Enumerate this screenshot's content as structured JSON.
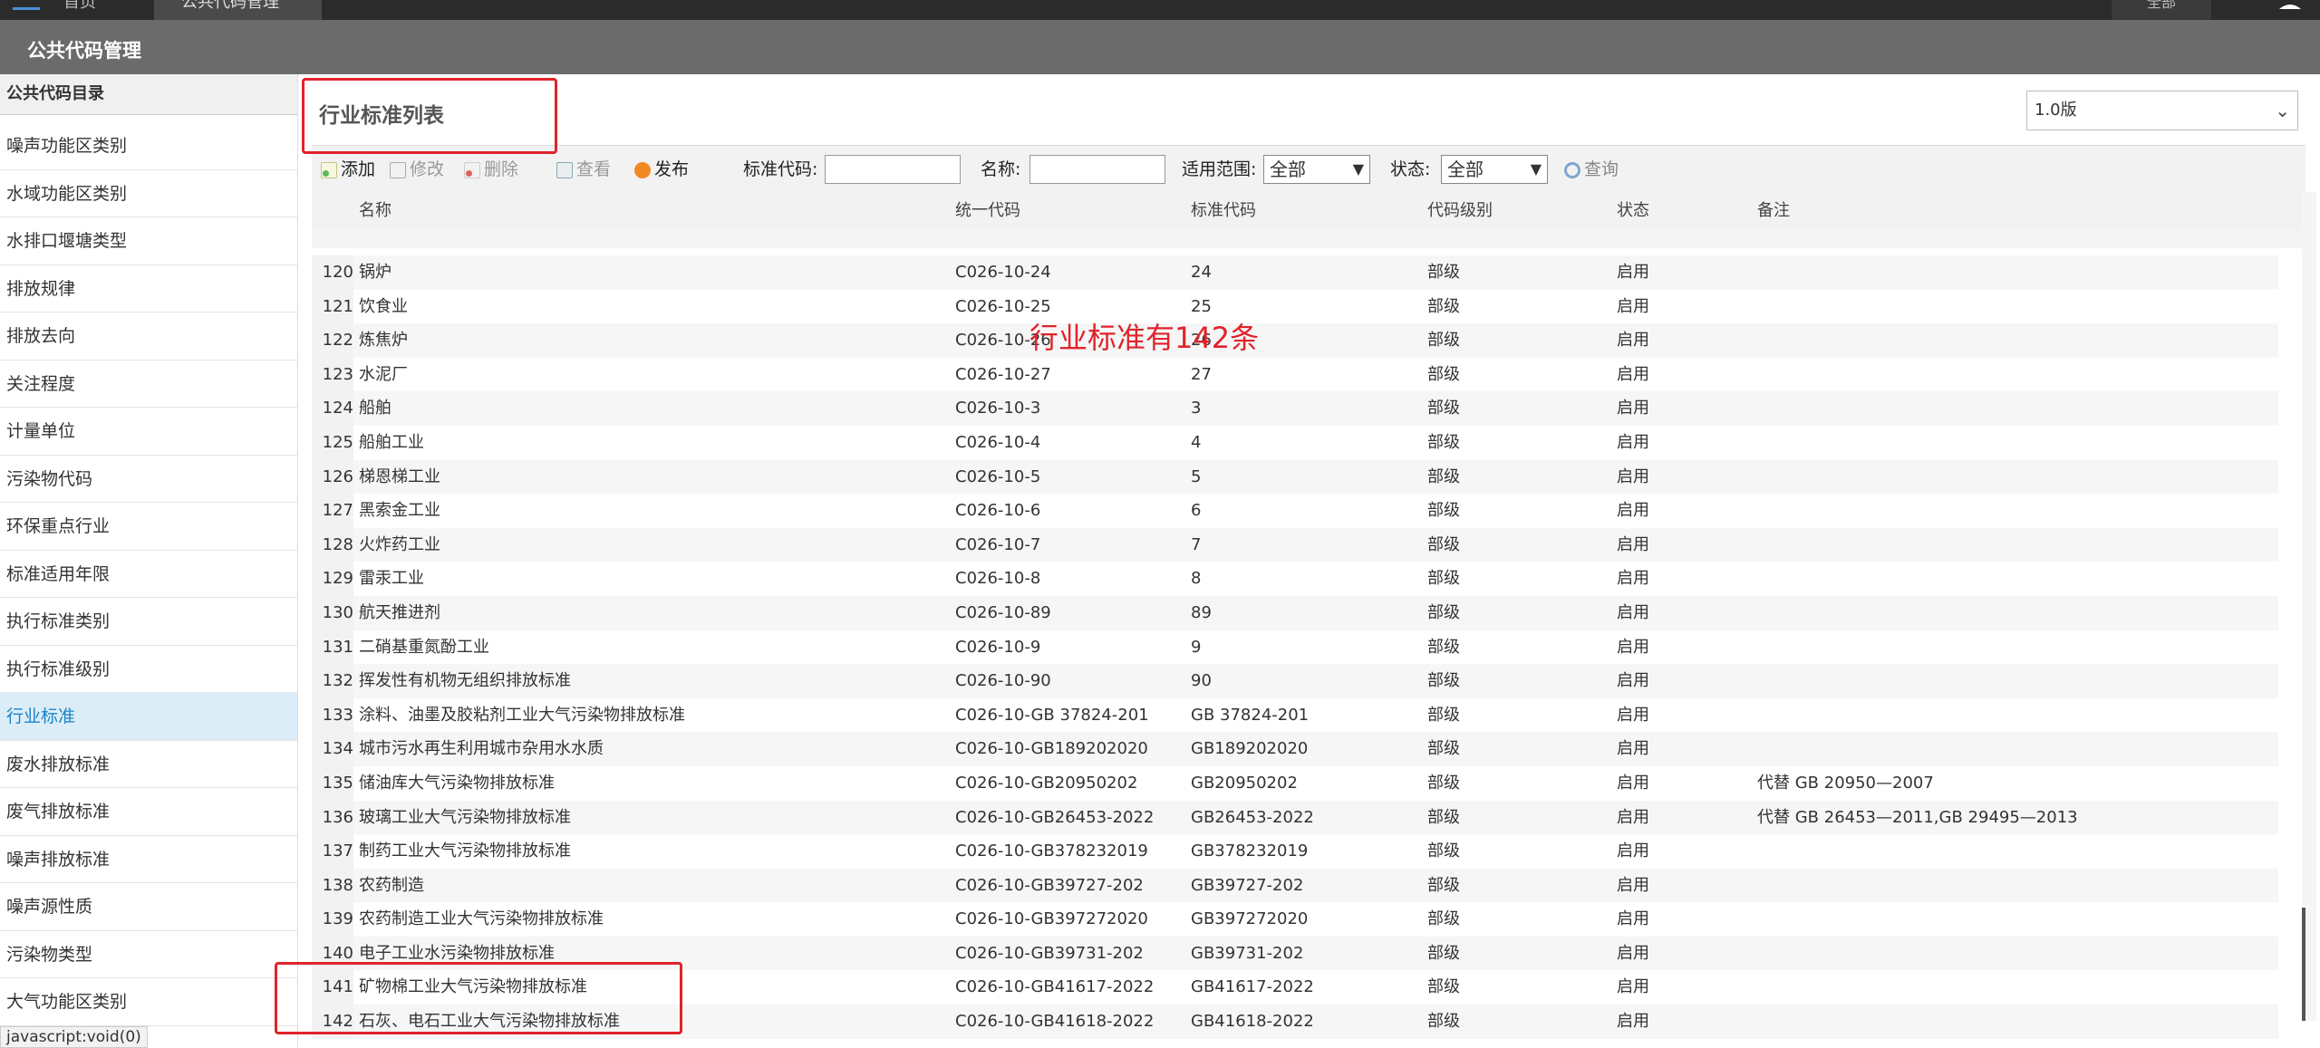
{
  "topbar": {
    "tab1": "首页",
    "tab2": "公共代码管理",
    "user_area": "全部"
  },
  "app_title": "公共代码管理",
  "sidebar": {
    "header": "公共代码目录",
    "items": [
      {
        "label": "噪声功能区类别"
      },
      {
        "label": "水域功能区类别"
      },
      {
        "label": "水排口堰塘类型"
      },
      {
        "label": "排放规律"
      },
      {
        "label": "排放去向"
      },
      {
        "label": "关注程度"
      },
      {
        "label": "计量单位"
      },
      {
        "label": "污染物代码"
      },
      {
        "label": "环保重点行业"
      },
      {
        "label": "标准适用年限"
      },
      {
        "label": "执行标准类别"
      },
      {
        "label": "执行标准级别"
      },
      {
        "label": "行业标准"
      },
      {
        "label": "废水排放标准"
      },
      {
        "label": "废气排放标准"
      },
      {
        "label": "噪声排放标准"
      },
      {
        "label": "噪声源性质"
      },
      {
        "label": "污染物类型"
      },
      {
        "label": "大气功能区类别"
      }
    ],
    "active_index": 12,
    "status_text": "javascript:void(0)"
  },
  "panel": {
    "title": "行业标准列表",
    "version": "1.0版"
  },
  "toolbar": {
    "add": "添加",
    "edit": "修改",
    "delete": "删除",
    "view": "查看",
    "publish": "发布",
    "std_code_label": "标准代码:",
    "name_label": "名称:",
    "scope_label": "适用范围:",
    "scope_value": "全部",
    "state_label": "状态:",
    "state_value": "全部",
    "search": "查询"
  },
  "table": {
    "headers": {
      "name": "名称",
      "unified": "统一代码",
      "std": "标准代码",
      "level": "代码级别",
      "state": "状态",
      "remark": "备注"
    },
    "rows": [
      {
        "no": "120",
        "name": "锅炉",
        "unified": "C026-10-24",
        "std": "24",
        "level": "部级",
        "state": "启用",
        "remark": ""
      },
      {
        "no": "121",
        "name": "饮食业",
        "unified": "C026-10-25",
        "std": "25",
        "level": "部级",
        "state": "启用",
        "remark": ""
      },
      {
        "no": "122",
        "name": "炼焦炉",
        "unified": "C026-10-26",
        "std": "26",
        "level": "部级",
        "state": "启用",
        "remark": ""
      },
      {
        "no": "123",
        "name": "水泥厂",
        "unified": "C026-10-27",
        "std": "27",
        "level": "部级",
        "state": "启用",
        "remark": ""
      },
      {
        "no": "124",
        "name": "船舶",
        "unified": "C026-10-3",
        "std": "3",
        "level": "部级",
        "state": "启用",
        "remark": ""
      },
      {
        "no": "125",
        "name": "船舶工业",
        "unified": "C026-10-4",
        "std": "4",
        "level": "部级",
        "state": "启用",
        "remark": ""
      },
      {
        "no": "126",
        "name": "梯恩梯工业",
        "unified": "C026-10-5",
        "std": "5",
        "level": "部级",
        "state": "启用",
        "remark": ""
      },
      {
        "no": "127",
        "name": "黑索金工业",
        "unified": "C026-10-6",
        "std": "6",
        "level": "部级",
        "state": "启用",
        "remark": ""
      },
      {
        "no": "128",
        "name": "火炸药工业",
        "unified": "C026-10-7",
        "std": "7",
        "level": "部级",
        "state": "启用",
        "remark": ""
      },
      {
        "no": "129",
        "name": "雷汞工业",
        "unified": "C026-10-8",
        "std": "8",
        "level": "部级",
        "state": "启用",
        "remark": ""
      },
      {
        "no": "130",
        "name": "航天推进剂",
        "unified": "C026-10-89",
        "std": "89",
        "level": "部级",
        "state": "启用",
        "remark": ""
      },
      {
        "no": "131",
        "name": "二硝基重氮酚工业",
        "unified": "C026-10-9",
        "std": "9",
        "level": "部级",
        "state": "启用",
        "remark": ""
      },
      {
        "no": "132",
        "name": "挥发性有机物无组织排放标准",
        "unified": "C026-10-90",
        "std": "90",
        "level": "部级",
        "state": "启用",
        "remark": ""
      },
      {
        "no": "133",
        "name": "涂料、油墨及胶粘剂工业大气污染物排放标准",
        "unified": "C026-10-GB 37824-201",
        "std": "GB 37824-201",
        "level": "部级",
        "state": "启用",
        "remark": ""
      },
      {
        "no": "134",
        "name": "城市污水再生利用城市杂用水水质",
        "unified": "C026-10-GB189202020",
        "std": "GB189202020",
        "level": "部级",
        "state": "启用",
        "remark": ""
      },
      {
        "no": "135",
        "name": "储油库大气污染物排放标准",
        "unified": "C026-10-GB20950202",
        "std": "GB20950202",
        "level": "部级",
        "state": "启用",
        "remark": "代替 GB 20950—2007"
      },
      {
        "no": "136",
        "name": "玻璃工业大气污染物排放标准",
        "unified": "C026-10-GB26453-2022",
        "std": "GB26453-2022",
        "level": "部级",
        "state": "启用",
        "remark": "代替 GB 26453—2011,GB 29495—2013"
      },
      {
        "no": "137",
        "name": "制药工业大气污染物排放标准",
        "unified": "C026-10-GB378232019",
        "std": "GB378232019",
        "level": "部级",
        "state": "启用",
        "remark": ""
      },
      {
        "no": "138",
        "name": "农药制造",
        "unified": "C026-10-GB39727-202",
        "std": "GB39727-202",
        "level": "部级",
        "state": "启用",
        "remark": ""
      },
      {
        "no": "139",
        "name": "农药制造工业大气污染物排放标准",
        "unified": "C026-10-GB397272020",
        "std": "GB397272020",
        "level": "部级",
        "state": "启用",
        "remark": ""
      },
      {
        "no": "140",
        "name": "电子工业水污染物排放标准",
        "unified": "C026-10-GB39731-202",
        "std": "GB39731-202",
        "level": "部级",
        "state": "启用",
        "remark": ""
      },
      {
        "no": "141",
        "name": "矿物棉工业大气污染物排放标准",
        "unified": "C026-10-GB41617-2022",
        "std": "GB41617-2022",
        "level": "部级",
        "state": "启用",
        "remark": ""
      },
      {
        "no": "142",
        "name": "石灰、电石工业大气污染物排放标准",
        "unified": "C026-10-GB41618-2022",
        "std": "GB41618-2022",
        "level": "部级",
        "state": "启用",
        "remark": ""
      }
    ]
  },
  "annotation": {
    "text": "行业标准有142条",
    "color": "#e0232b"
  },
  "colors": {
    "accent": "#1a84c6",
    "titlebar": "#6b6b6b",
    "annotation": "#e0232b"
  }
}
